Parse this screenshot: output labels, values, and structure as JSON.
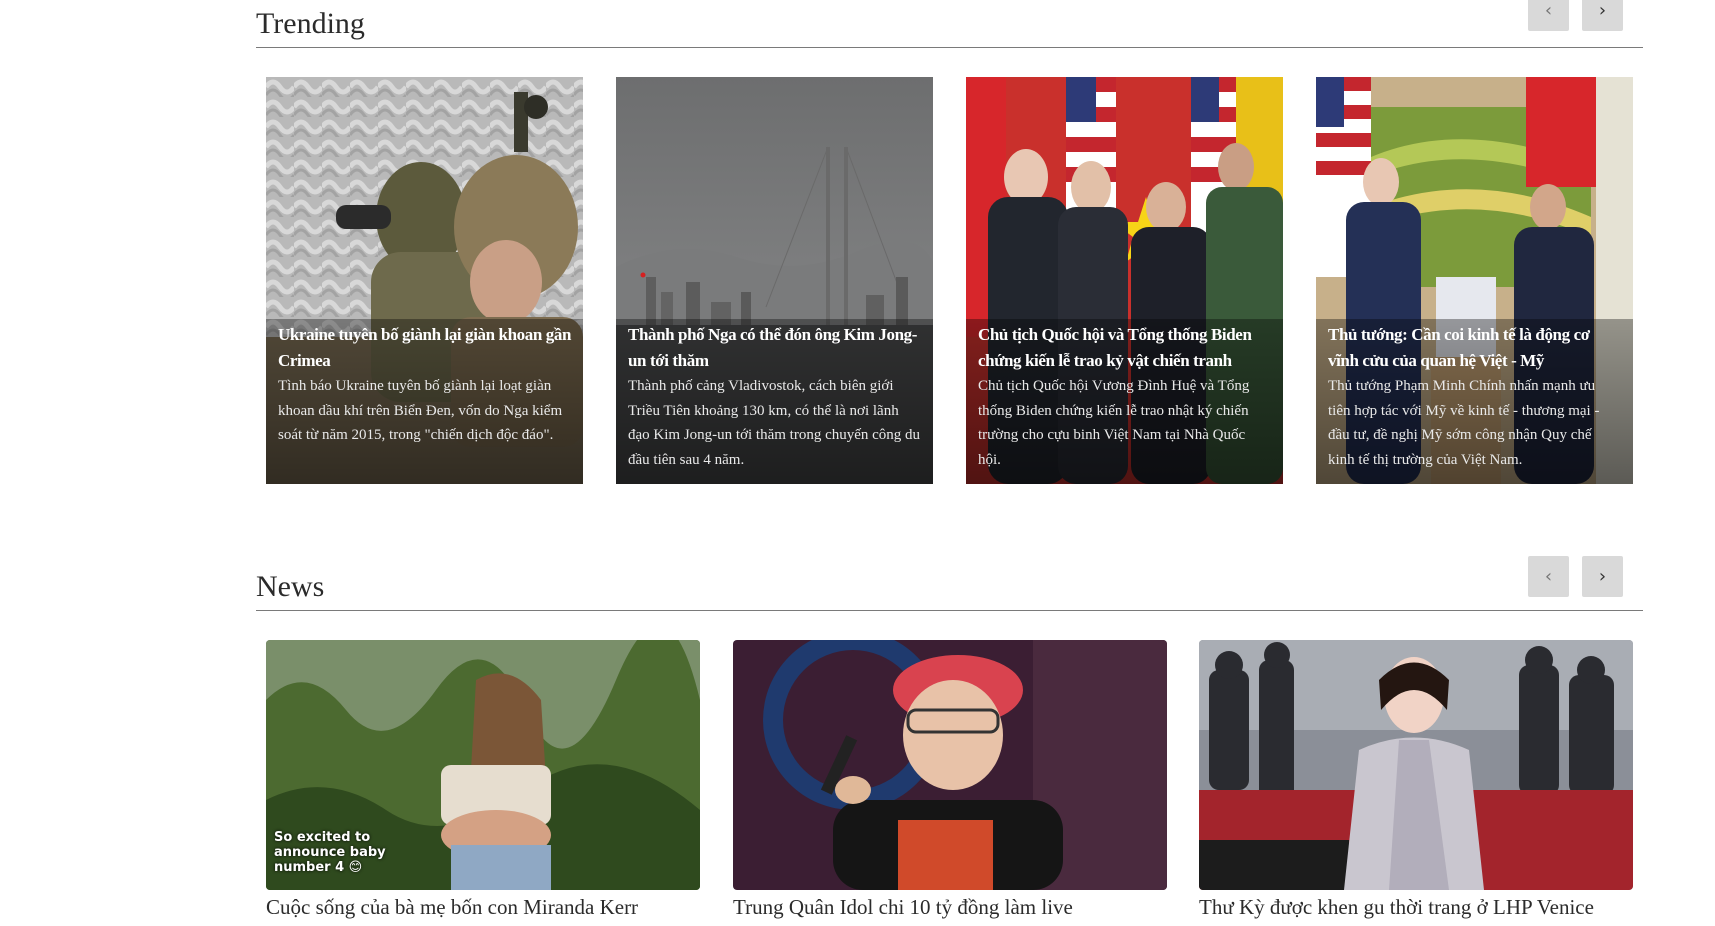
{
  "trending": {
    "title": "Trending",
    "prev_label": "‹",
    "next_label": "›",
    "cards": [
      {
        "title": "Ukraine tuyên bố giành lại giàn khoan gần Crimea",
        "desc": "Tình báo Ukraine tuyên bố giành lại loạt giàn khoan dầu khí trên Biển Đen, vốn do Nga kiểm soát từ năm 2015, trong \"chiến dịch độc đáo\"."
      },
      {
        "title": "Thành phố Nga có thể đón ông Kim Jong-un tới thăm",
        "desc": "Thành phố cảng Vladivostok, cách biên giới Triều Tiên khoảng 130 km, có thể là nơi lãnh đạo Kim Jong-un tới thăm trong chuyến công du đầu tiên sau 4 năm."
      },
      {
        "title": "Chủ tịch Quốc hội và Tổng thống Biden chứng kiến lễ trao kỷ vật chiến tranh",
        "desc": "Chủ tịch Quốc hội Vương Đình Huệ và Tổng thống Biden chứng kiến lễ trao nhật ký chiến trường cho cựu binh Việt Nam tại Nhà Quốc hội."
      },
      {
        "title": "Thủ tướng: Cần coi kinh tế là động cơ vĩnh cửu của quan hệ Việt - Mỹ",
        "desc": "Thủ tướng Phạm Minh Chính nhấn mạnh ưu tiên hợp tác với Mỹ về kinh tế - thương mại - đầu tư, đề nghị Mỹ sớm công nhận Quy chế kinh tế thị trường của Việt Nam."
      }
    ]
  },
  "news": {
    "title": "News",
    "prev_label": "‹",
    "next_label": "›",
    "cards": [
      {
        "title": "Cuộc sống của bà mẹ bốn con Miranda Kerr",
        "image_text": "So excited to\nannounce baby\nnumber 4 😊"
      },
      {
        "title": "Trung Quân Idol chi 10 tỷ đồng làm live"
      },
      {
        "title": "Thư Kỳ được khen gu thời trang ở LHP Venice"
      }
    ]
  },
  "colors": {
    "button_bg": "#d9d9d9",
    "divider": "#7a7a7a",
    "title_text": "#2b2b2b"
  }
}
